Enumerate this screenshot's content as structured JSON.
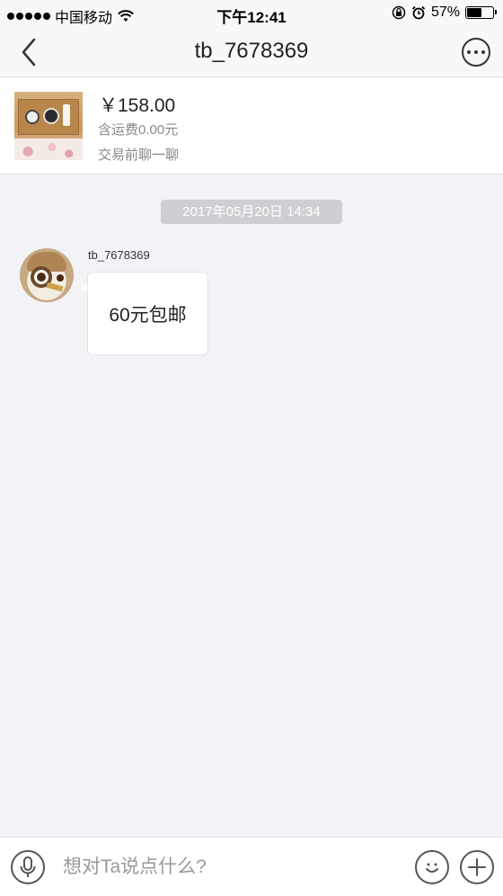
{
  "status_bar": {
    "carrier": "中国移动",
    "time": "下午12:41",
    "battery_percent": "57%",
    "battery_level": 0.57,
    "icons": [
      "signal-dots-icon",
      "wifi-icon",
      "rotation-lock-icon",
      "alarm-icon",
      "battery-icon"
    ]
  },
  "nav": {
    "title": "tb_7678369",
    "back_icon": "chevron-left-icon",
    "more_icon": "more-dots-icon"
  },
  "product": {
    "price": "￥158.00",
    "shipping": "含运费0.00元",
    "chat_prompt": "交易前聊一聊"
  },
  "chat": {
    "timestamp": "2017年05月20日 14:34",
    "messages": [
      {
        "sender": "tb_7678369",
        "text": "60元包邮"
      }
    ]
  },
  "input_bar": {
    "placeholder": "想对Ta说点什么?",
    "icons": [
      "microphone-icon",
      "smiley-icon",
      "plus-icon"
    ]
  },
  "colors": {
    "background": "#f2f3f7",
    "nav_background": "#f8f8fa",
    "timestamp_bg": "#cfcfd3"
  }
}
